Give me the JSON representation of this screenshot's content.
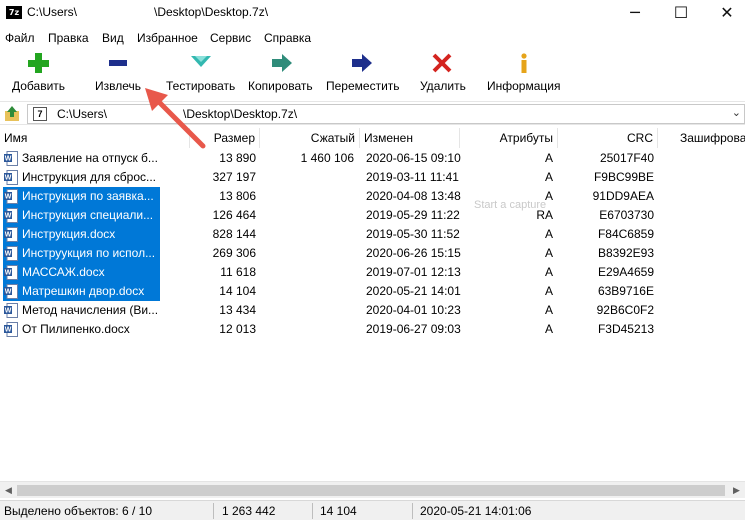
{
  "window": {
    "title_part1": "C:\\Users\\",
    "title_part2": "\\Desktop\\Desktop.7z\\",
    "app_icon": "7z",
    "minimize": "─",
    "maximize": "☐",
    "close": "✕"
  },
  "menu": [
    "Файл",
    "Правка",
    "Вид",
    "Избранное",
    "Сервис",
    "Справка"
  ],
  "toolbar": {
    "add": "Добавить",
    "extract": "Извлечь",
    "test": "Тестировать",
    "copy": "Копировать",
    "move": "Переместить",
    "delete": "Удалить",
    "info": "Информация"
  },
  "address": {
    "part1": "C:\\Users\\",
    "part2": "\\Desktop\\Desktop.7z\\"
  },
  "columns": {
    "name": "Имя",
    "size": "Размер",
    "packed": "Сжатый",
    "modified": "Изменен",
    "attributes": "Атрибуты",
    "crc": "CRC",
    "encrypted": "Зашифрова"
  },
  "files": [
    {
      "name": "Заявление на отпуск б...",
      "size": "13 890",
      "packed": "1 460 106",
      "modified": "2020-06-15 09:10",
      "attr": "A",
      "crc": "25017F40",
      "selected": false
    },
    {
      "name": "Инструкция для сброс...",
      "size": "327 197",
      "packed": "",
      "modified": "2019-03-11 11:41",
      "attr": "A",
      "crc": "F9BC99BE",
      "selected": false
    },
    {
      "name": "Инструкция по заявка...",
      "size": "13 806",
      "packed": "",
      "modified": "2020-04-08 13:48",
      "attr": "A",
      "crc": "91DD9AEA",
      "selected": true
    },
    {
      "name": "Инструкция специали...",
      "size": "126 464",
      "packed": "",
      "modified": "2019-05-29 11:22",
      "attr": "RA",
      "crc": "E6703730",
      "selected": true
    },
    {
      "name": "Инструкция.docx",
      "size": "828 144",
      "packed": "",
      "modified": "2019-05-30 11:52",
      "attr": "A",
      "crc": "F84C6859",
      "selected": true
    },
    {
      "name": "Инструукция по испол...",
      "size": "269 306",
      "packed": "",
      "modified": "2020-06-26 15:15",
      "attr": "A",
      "crc": "B8392E93",
      "selected": true
    },
    {
      "name": "МАССАЖ.docx",
      "size": "11 618",
      "packed": "",
      "modified": "2019-07-01 12:13",
      "attr": "A",
      "crc": "E29A4659",
      "selected": true
    },
    {
      "name": "Матрешкин двор.docx",
      "size": "14 104",
      "packed": "",
      "modified": "2020-05-21 14:01",
      "attr": "A",
      "crc": "63B9716E",
      "selected": true
    },
    {
      "name": "Метод начисления (Ви...",
      "size": "13 434",
      "packed": "",
      "modified": "2020-04-01 10:23",
      "attr": "A",
      "crc": "92B6C0F2",
      "selected": false
    },
    {
      "name": "От Пилипенко.docx",
      "size": "12 013",
      "packed": "",
      "modified": "2019-06-27 09:03",
      "attr": "A",
      "crc": "F3D45213",
      "selected": false
    }
  ],
  "watermark": "Start a capture",
  "status": {
    "selected": "Выделено объектов: 6 / 10",
    "total": "1 263 442",
    "size": "14 104",
    "date": "2020-05-21 14:01:06"
  },
  "colors": {
    "selection": "#0078d7",
    "annotation_arrow": "#e8584b"
  }
}
